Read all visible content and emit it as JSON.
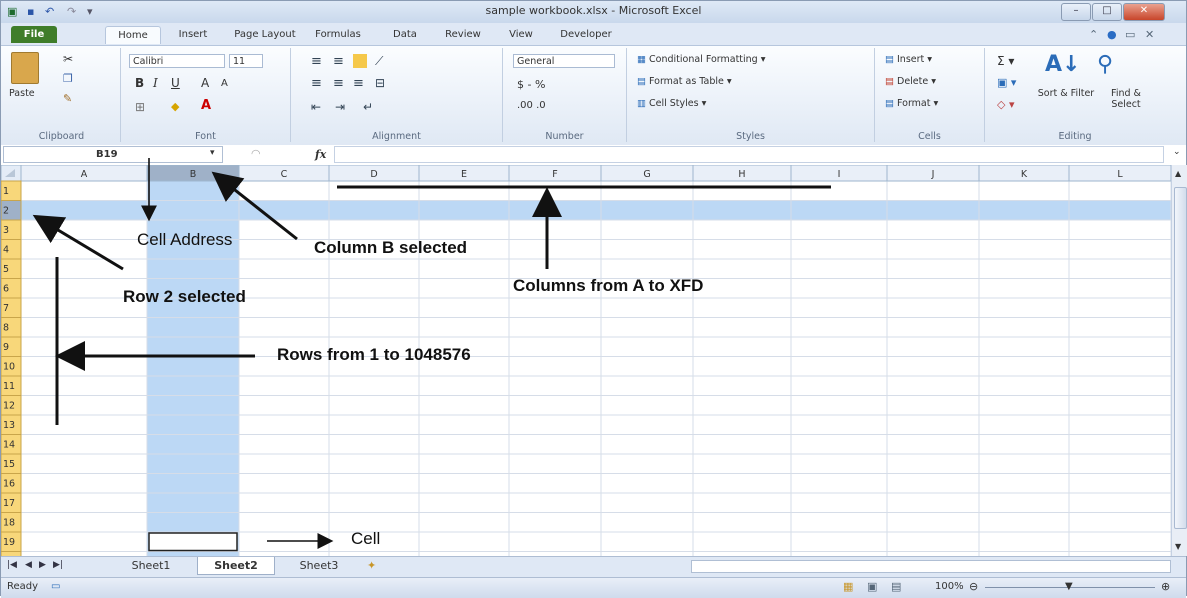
{
  "window": {
    "title": "sample workbook.xlsx - Microsoft Excel"
  },
  "tabs": [
    "File",
    "Home",
    "Insert",
    "Page Layout",
    "Formulas",
    "Data",
    "Review",
    "View",
    "Developer"
  ],
  "ribbon": {
    "clipboard": {
      "paste": "Paste",
      "label": "Clipboard"
    },
    "font": {
      "name": "Calibri",
      "size": "11",
      "label": "Font"
    },
    "alignment": {
      "label": "Alignment"
    },
    "number": {
      "format": "General",
      "currency": "$ - %",
      "decimals": ".00 .0",
      "label": "Number"
    },
    "styles": {
      "conditional": "Conditional Formatting",
      "format_table": "Format as Table",
      "cell_styles": "Cell Styles",
      "label": "Styles"
    },
    "cells": {
      "insert": "Insert",
      "delete": "Delete",
      "format": "Format",
      "label": "Cells"
    },
    "editing": {
      "sort": "Sort & Filter",
      "find": "Find & Select",
      "label": "Editing"
    }
  },
  "formula_bar": {
    "name_box": "B19",
    "fx": "fx",
    "content": ""
  },
  "grid": {
    "columns": [
      "A",
      "B",
      "C",
      "D",
      "E",
      "F",
      "G",
      "H",
      "I",
      "J",
      "K",
      "L"
    ],
    "rows": [
      "1",
      "2",
      "3",
      "4",
      "5",
      "6",
      "7",
      "8",
      "9",
      "10",
      "11",
      "12",
      "13",
      "14",
      "15",
      "16",
      "17",
      "18",
      "19"
    ],
    "selected_column": "B",
    "selected_row": "2",
    "active_cell": "B19"
  },
  "sheets": [
    "Sheet1",
    "Sheet2",
    "Sheet3"
  ],
  "active_sheet": "Sheet2",
  "status": {
    "ready": "Ready",
    "zoom": "100%"
  },
  "annotations": {
    "cell_address": "Cell Address",
    "column_b": "Column B selected",
    "columns_range": "Columns from A to XFD",
    "row_2": "Row 2 selected",
    "rows_range": "Rows from 1 to 1048576",
    "cell": "Cell"
  },
  "colors": {
    "selection": "#bcd8f5",
    "header_selected": "#f8d77a",
    "file_tab": "#3f7d2a"
  }
}
